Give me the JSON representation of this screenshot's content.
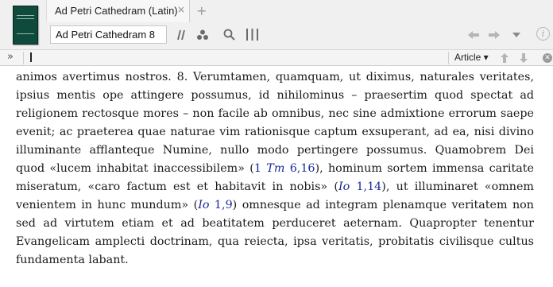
{
  "tab": {
    "title": "Ad Petri Cathedram (Latin)",
    "close": "×",
    "add": "+"
  },
  "book_cover": {
    "color": "#0f4a3c"
  },
  "toolbar": {
    "reference_value": "Ad Petri Cathedram 8",
    "icons": [
      "parallel-icon",
      "visual-filter-icon",
      "search-icon",
      "columns-icon",
      "back-icon",
      "forward-icon",
      "dropdown-icon",
      "info-icon"
    ],
    "info_label": "i"
  },
  "subbar": {
    "expand_label": "»",
    "article_label": "Article ▾",
    "up_label": "🡑",
    "down_label": "🡓"
  },
  "colors": {
    "reference_link": "#1b2a9c",
    "toolbar_bg": "#f0f0f0"
  },
  "content": {
    "lines": [
      {
        "parts": [
          {
            "text": "animos avertimus nostros. 8. Verumtamen, quamquam, ut diximus, naturales veritates,"
          }
        ]
      },
      {
        "parts": [
          {
            "text": "ipsius mentis ope attingere possumus, id nihilominus – praesertim quod spectat ad"
          }
        ]
      },
      {
        "parts": [
          {
            "text": "religionem rectosque mores – non facile ab omnibus, nec sine admixtione errorum saepe"
          }
        ]
      },
      {
        "parts": [
          {
            "text": "evenit; ac praeterea quae naturae vim rationisque captum exsuperant, ad ea, nisi divino"
          }
        ]
      },
      {
        "parts": [
          {
            "text": "illuminante afflanteque Numine, nullo modo pertingere possumus. Quamobrem Dei Verbum,"
          }
        ]
      },
      {
        "parts": [
          {
            "text": "quod «lucem inhabitat inaccessibilem» ("
          },
          {
            "text": "1 ",
            "ref": true
          },
          {
            "text": "Tm",
            "ref": true,
            "italic": true
          },
          {
            "text": " 6,16",
            "ref": true
          },
          {
            "text": "), hominum sortem immensa caritate"
          }
        ]
      },
      {
        "parts": [
          {
            "text": "miseratum, «caro factum est et habitavit in nobis» ("
          },
          {
            "text": "Io",
            "ref": true,
            "italic": true
          },
          {
            "text": " 1,14",
            "ref": true
          },
          {
            "text": "), ut illuminaret «omnem hominem"
          }
        ]
      },
      {
        "parts": [
          {
            "text": "venientem in hunc mundum» ("
          },
          {
            "text": "Io",
            "ref": true,
            "italic": true
          },
          {
            "text": " 1,9",
            "ref": true
          },
          {
            "text": ") omnesque ad integram plenamque veritatem non modo,"
          }
        ]
      },
      {
        "parts": [
          {
            "text": "sed ad virtutem etiam et ad beatitatem perduceret aeternam. Quapropter tenentur omnes"
          }
        ]
      },
      {
        "parts": [
          {
            "text": "Evangelicam amplecti doctrinam, qua reiecta, ipsa veritatis, probitatis civilisque cultus"
          }
        ]
      },
      {
        "parts": [
          {
            "text": "fundamenta labant."
          }
        ],
        "last": true
      }
    ]
  }
}
